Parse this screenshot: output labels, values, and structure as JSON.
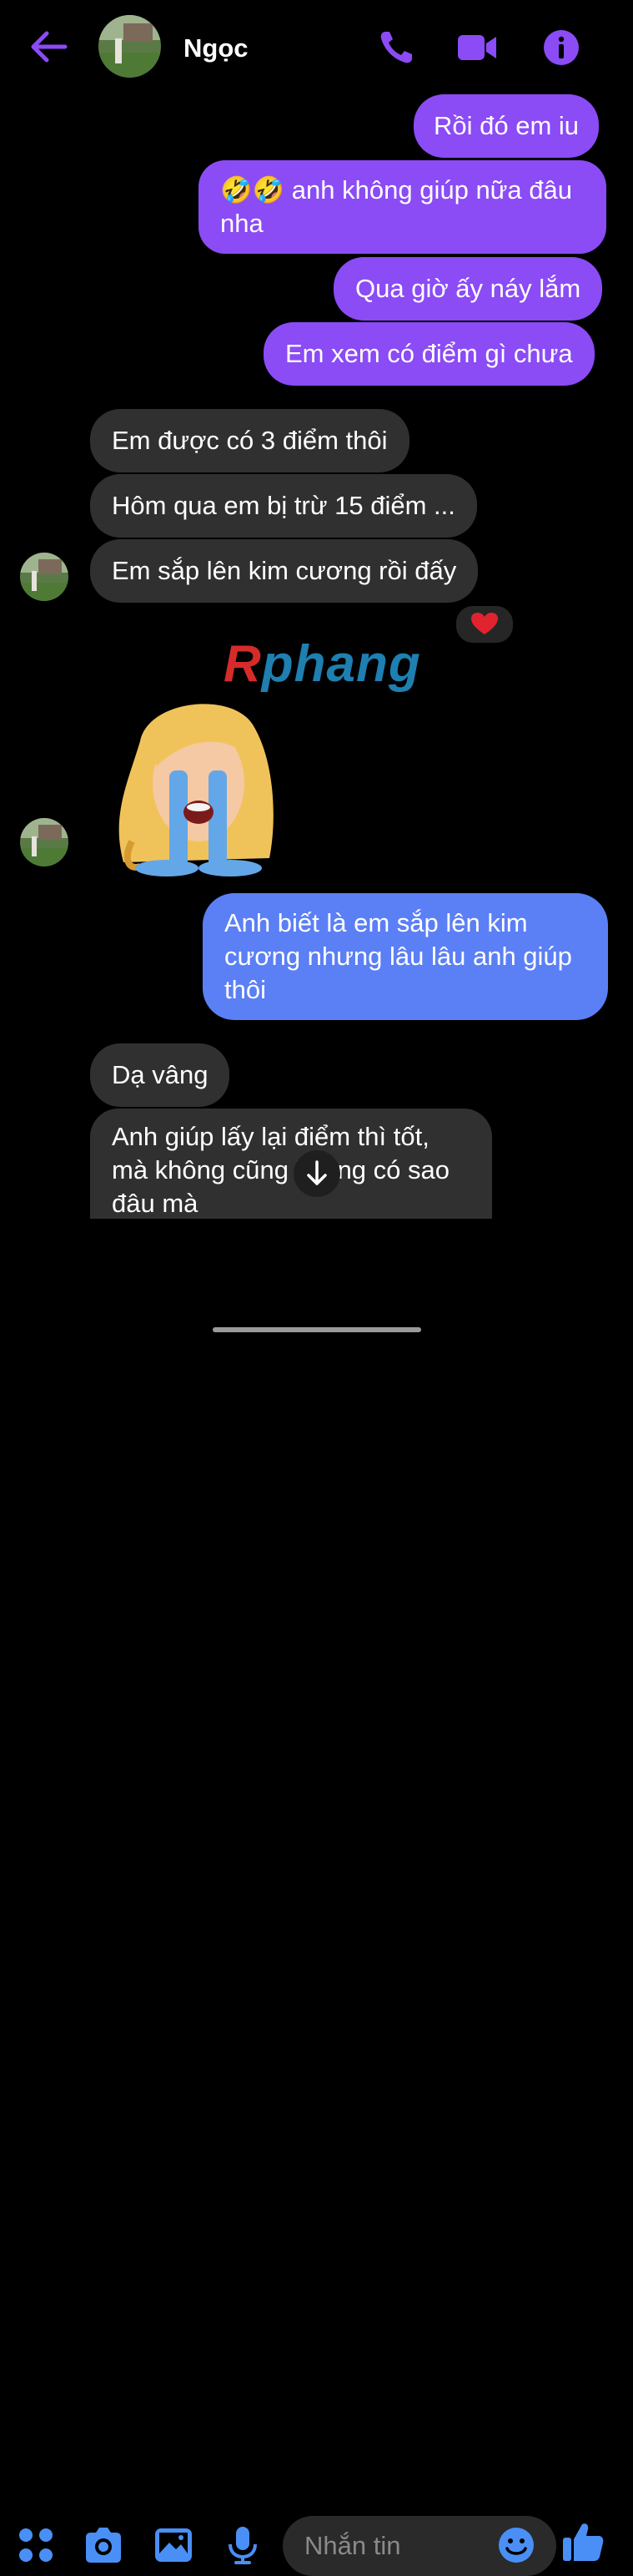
{
  "header": {
    "contact_name": "Ngọc",
    "back_icon": "back-arrow-icon",
    "call_icon": "phone-icon",
    "video_icon": "video-camera-icon",
    "info_icon": "info-icon",
    "accent_color": "#8b4bf5"
  },
  "messages": [
    {
      "from": "me",
      "text": "Rồi đó em iu"
    },
    {
      "from": "me",
      "text": "🤣🤣 anh không giúp nữa đâu nha"
    },
    {
      "from": "me",
      "text": "Qua giờ ấy náy lắm"
    },
    {
      "from": "me",
      "text": "Em xem có điểm gì chưa"
    },
    {
      "from": "contact",
      "text": "Em được có 3 điểm thôi"
    },
    {
      "from": "contact",
      "text": "Hôm qua em bị trừ 15 điểm ..."
    },
    {
      "from": "contact",
      "text": "Em sắp lên kim cương rồi đấy",
      "reaction": "❤️"
    },
    {
      "from": "contact",
      "type": "sticker",
      "sticker": "crying-woman-sticker"
    },
    {
      "from": "me",
      "text": "Anh biết là em sắp lên kim cương nhưng lâu lâu anh giúp thôi"
    },
    {
      "from": "contact",
      "text": "Dạ vâng"
    },
    {
      "from": "contact",
      "text": "Anh giúp lấy lại điểm thì tốt, mà không cũng không có sao đâu mà"
    }
  ],
  "watermark": {
    "first": "R",
    "rest": "phang"
  },
  "composer": {
    "placeholder": "Nhắn tin",
    "icons": [
      "apps-icon",
      "camera-icon",
      "gallery-icon",
      "microphone-icon",
      "emoji-icon",
      "thumbs-up-icon"
    ],
    "icon_color": "#4a8ff5"
  },
  "colors": {
    "outgoing_bubble": "#8b4bf5",
    "outgoing_bubble_blue": "#5b7ff5",
    "incoming_bubble": "#303030",
    "background": "#000000"
  }
}
